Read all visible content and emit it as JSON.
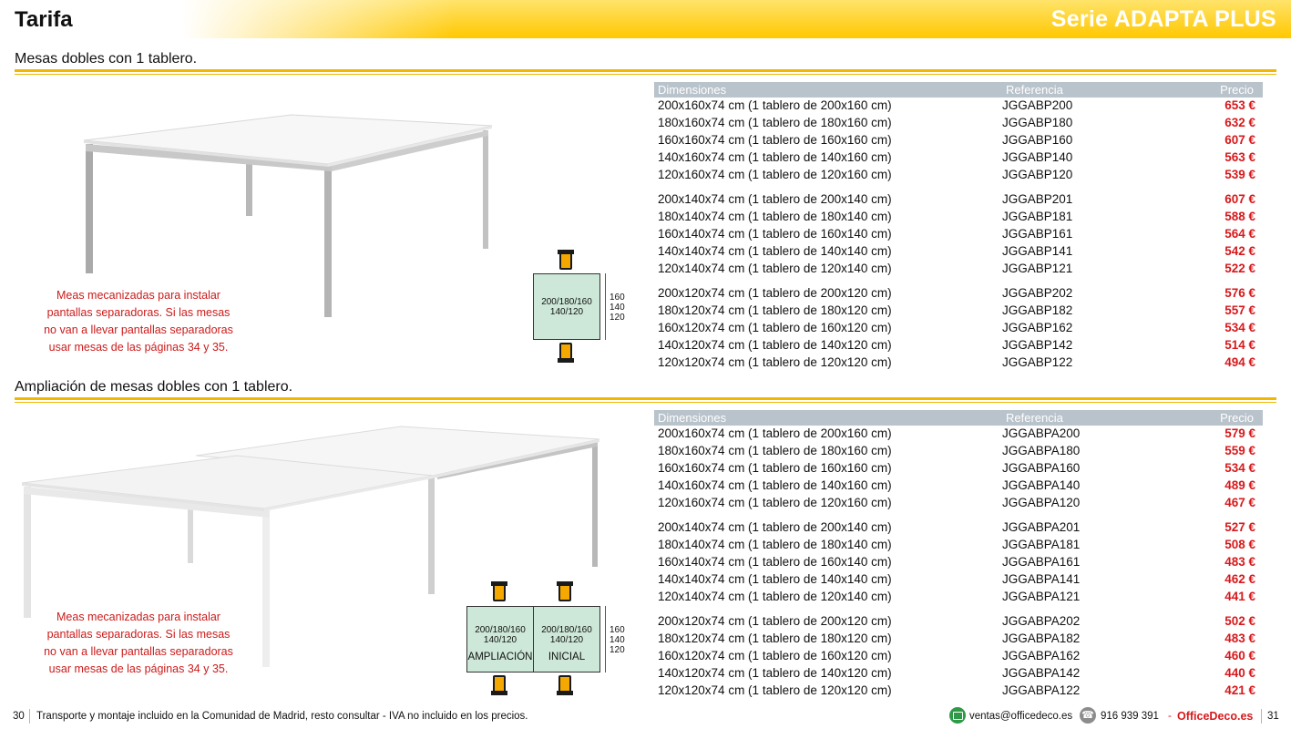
{
  "header": {
    "title": "Tarifa",
    "series": "Serie ADAPTA PLUS"
  },
  "colors": {
    "accent": "#ffc800",
    "price": "#d7191c",
    "table_header": "#b9c3cb",
    "layout_fill": "#cde8d8"
  },
  "sections": [
    {
      "title": "Mesas dobles con 1 tablero.",
      "note": [
        "Meas mecanizadas para instalar",
        "pantallas separadoras. Si las mesas",
        "no van a llevar pantallas separadoras",
        "usar mesas de las páginas 34 y 35."
      ],
      "layout": {
        "boxes": [
          {
            "widths": "200/180/160",
            "depths": "140/120",
            "caption": ""
          }
        ],
        "side": [
          "160",
          "140",
          "120"
        ]
      },
      "table": {
        "headers": {
          "dim": "Dimensiones",
          "ref": "Referencia",
          "price": "Precio"
        },
        "groups": [
          [
            {
              "dim": "200x160x74 cm (1 tablero de 200x160 cm)",
              "ref": "JGGABP200",
              "price": "653 €"
            },
            {
              "dim": "180x160x74 cm (1 tablero de 180x160 cm)",
              "ref": "JGGABP180",
              "price": "632 €"
            },
            {
              "dim": "160x160x74 cm (1 tablero de 160x160 cm)",
              "ref": "JGGABP160",
              "price": "607 €"
            },
            {
              "dim": "140x160x74 cm (1 tablero de 140x160 cm)",
              "ref": "JGGABP140",
              "price": "563 €"
            },
            {
              "dim": "120x160x74 cm (1 tablero de 120x160 cm)",
              "ref": "JGGABP120",
              "price": "539 €"
            }
          ],
          [
            {
              "dim": "200x140x74 cm (1 tablero de 200x140 cm)",
              "ref": "JGGABP201",
              "price": "607 €"
            },
            {
              "dim": "180x140x74 cm (1 tablero de 180x140 cm)",
              "ref": "JGGABP181",
              "price": "588 €"
            },
            {
              "dim": "160x140x74 cm (1 tablero de 160x140 cm)",
              "ref": "JGGABP161",
              "price": "564 €"
            },
            {
              "dim": "140x140x74 cm (1 tablero de 140x140 cm)",
              "ref": "JGGABP141",
              "price": "542 €"
            },
            {
              "dim": "120x140x74 cm (1 tablero de 120x140 cm)",
              "ref": "JGGABP121",
              "price": "522 €"
            }
          ],
          [
            {
              "dim": "200x120x74 cm (1 tablero de 200x120 cm)",
              "ref": "JGGABP202",
              "price": "576 €"
            },
            {
              "dim": "180x120x74 cm (1 tablero de 180x120 cm)",
              "ref": "JGGABP182",
              "price": "557 €"
            },
            {
              "dim": "160x120x74 cm (1 tablero de 160x120 cm)",
              "ref": "JGGABP162",
              "price": "534 €"
            },
            {
              "dim": "140x120x74 cm (1 tablero de 140x120 cm)",
              "ref": "JGGABP142",
              "price": "514 €"
            },
            {
              "dim": "120x120x74 cm (1 tablero de 120x120 cm)",
              "ref": "JGGABP122",
              "price": "494 €"
            }
          ]
        ]
      }
    },
    {
      "title": "Ampliación de mesas dobles con 1 tablero.",
      "note": [
        "Meas mecanizadas para instalar",
        "pantallas separadoras. Si las mesas",
        "no van a llevar pantallas separadoras",
        "usar mesas de las páginas 34 y 35."
      ],
      "layout": {
        "boxes": [
          {
            "widths": "200/180/160",
            "depths": "140/120",
            "caption": "AMPLIACIÓN"
          },
          {
            "widths": "200/180/160",
            "depths": "140/120",
            "caption": "INICIAL"
          }
        ],
        "side": [
          "160",
          "140",
          "120"
        ]
      },
      "table": {
        "headers": {
          "dim": "Dimensiones",
          "ref": "Referencia",
          "price": "Precio"
        },
        "groups": [
          [
            {
              "dim": "200x160x74 cm (1 tablero de 200x160 cm)",
              "ref": "JGGABPA200",
              "price": "579 €"
            },
            {
              "dim": "180x160x74 cm (1 tablero de 180x160 cm)",
              "ref": "JGGABPA180",
              "price": "559 €"
            },
            {
              "dim": "160x160x74 cm (1 tablero de 160x160 cm)",
              "ref": "JGGABPA160",
              "price": "534 €"
            },
            {
              "dim": "140x160x74 cm (1 tablero de 140x160 cm)",
              "ref": "JGGABPA140",
              "price": "489 €"
            },
            {
              "dim": "120x160x74 cm (1 tablero de 120x160 cm)",
              "ref": "JGGABPA120",
              "price": "467 €"
            }
          ],
          [
            {
              "dim": "200x140x74 cm (1 tablero de 200x140 cm)",
              "ref": "JGGABPA201",
              "price": "527 €"
            },
            {
              "dim": "180x140x74 cm (1 tablero de 180x140 cm)",
              "ref": "JGGABPA181",
              "price": "508 €"
            },
            {
              "dim": "160x140x74 cm (1 tablero de 160x140 cm)",
              "ref": "JGGABPA161",
              "price": "483 €"
            },
            {
              "dim": "140x140x74 cm (1 tablero de 140x140 cm)",
              "ref": "JGGABPA141",
              "price": "462 €"
            },
            {
              "dim": "120x140x74 cm (1 tablero de 120x140 cm)",
              "ref": "JGGABPA121",
              "price": "441 €"
            }
          ],
          [
            {
              "dim": "200x120x74 cm (1 tablero de 200x120 cm)",
              "ref": "JGGABPA202",
              "price": "502 €"
            },
            {
              "dim": "180x120x74 cm (1 tablero de 180x120 cm)",
              "ref": "JGGABPA182",
              "price": "483 €"
            },
            {
              "dim": "160x120x74 cm (1 tablero de 160x120 cm)",
              "ref": "JGGABPA162",
              "price": "460 €"
            },
            {
              "dim": "140x120x74 cm (1 tablero de 140x120 cm)",
              "ref": "JGGABPA142",
              "price": "440 €"
            },
            {
              "dim": "120x120x74 cm (1 tablero de 120x120 cm)",
              "ref": "JGGABPA122",
              "price": "421 €"
            }
          ]
        ]
      }
    }
  ],
  "footer": {
    "page_left": "30",
    "legal": "Transporte y montaje incluido en la Comunidad de Madrid, resto consultar - IVA no incluido en los precios.",
    "email": "ventas@officedeco.es",
    "phone": "916 939 391",
    "dash": "-",
    "brand": "OfficeDeco.es",
    "page_right": "31",
    "email_icon": "mail-icon",
    "phone_icon": "phone-icon"
  }
}
